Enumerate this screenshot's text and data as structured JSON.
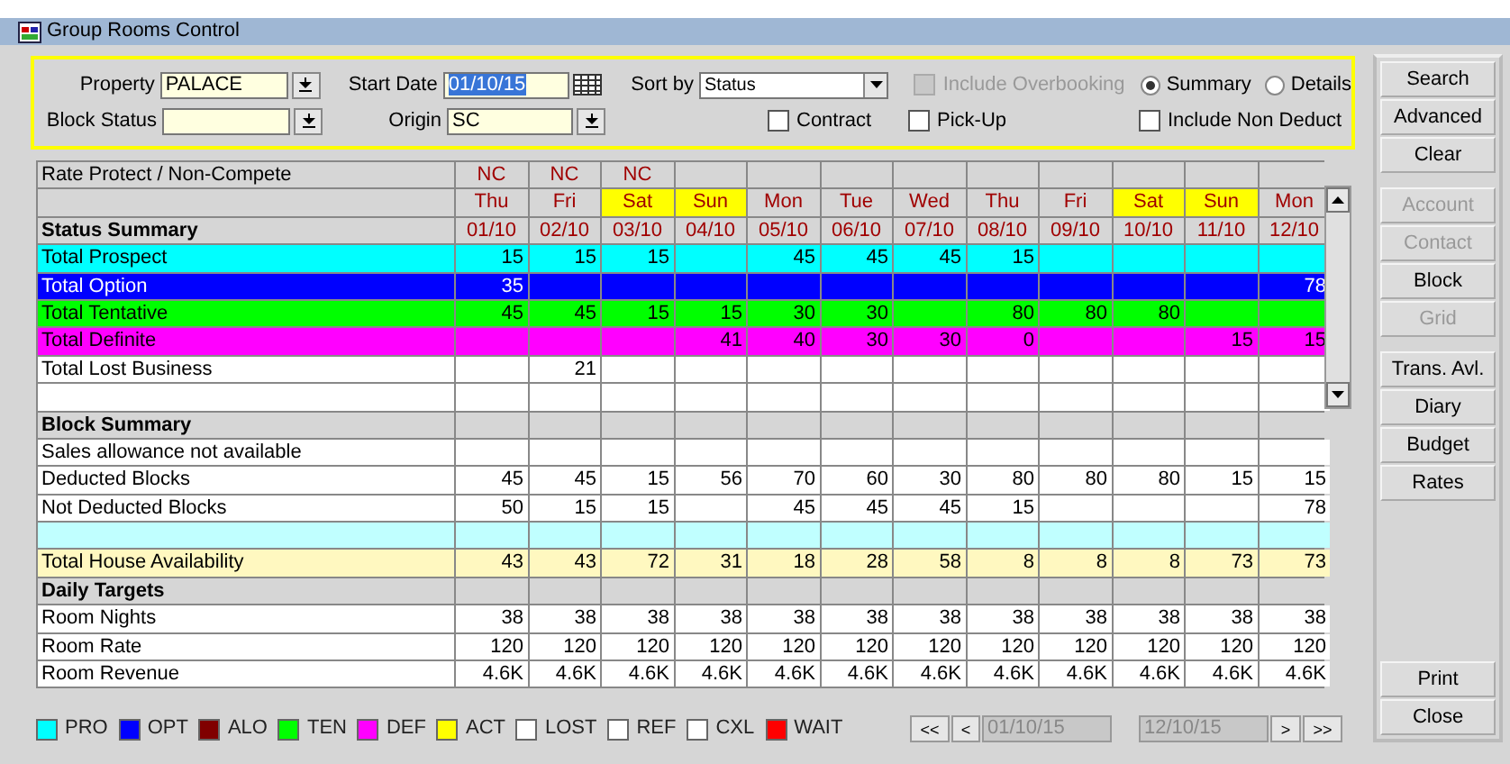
{
  "window": {
    "title": "Group Rooms Control"
  },
  "filters": {
    "property": {
      "label": "Property",
      "value": "PALACE"
    },
    "start_date": {
      "label": "Start Date",
      "value": "01/10/15",
      "selected": true
    },
    "sort_by": {
      "label": "Sort by",
      "value": "Status"
    },
    "block_status": {
      "label": "Block Status"
    },
    "origin": {
      "label": "Origin",
      "value": "SC"
    },
    "checkboxes": [
      {
        "label": "Include Overbooking",
        "checked": false,
        "disabled": true
      },
      {
        "label": "Contract",
        "checked": false,
        "disabled": false
      },
      {
        "label": "Pick-Up",
        "checked": false,
        "disabled": false
      },
      {
        "label": "Include Non Deduct",
        "checked": false,
        "disabled": false
      }
    ],
    "view": [
      {
        "label": "Summary",
        "selected": true
      },
      {
        "label": "Details",
        "selected": false
      }
    ]
  },
  "grid": {
    "title": "Rate Protect / Non-Compete",
    "section_title": "Status Summary",
    "columns": [
      {
        "nc": "NC",
        "day": "Thu",
        "date": "01/10",
        "weekend": false
      },
      {
        "nc": "NC",
        "day": "Fri",
        "date": "02/10",
        "weekend": false
      },
      {
        "nc": "NC",
        "day": "Sat",
        "date": "03/10",
        "weekend": true
      },
      {
        "day": "Sun",
        "date": "04/10",
        "weekend": true
      },
      {
        "day": "Mon",
        "date": "05/10",
        "weekend": false
      },
      {
        "day": "Tue",
        "date": "06/10",
        "weekend": false
      },
      {
        "day": "Wed",
        "date": "07/10",
        "weekend": false
      },
      {
        "day": "Thu",
        "date": "08/10",
        "weekend": false
      },
      {
        "day": "Fri",
        "date": "09/10",
        "weekend": false
      },
      {
        "day": "Sat",
        "date": "10/10",
        "weekend": true
      },
      {
        "day": "Sun",
        "date": "11/10",
        "weekend": true
      },
      {
        "day": "Mon",
        "date": "12/10",
        "weekend": false
      }
    ],
    "rows": [
      {
        "kind": "status",
        "label": "Total Prospect",
        "color": "#00ffff",
        "values": {
          "0": "15",
          "1": "15",
          "2": "15",
          "4": "45",
          "5": "45",
          "6": "45",
          "7": "15"
        }
      },
      {
        "kind": "status",
        "label": "Total Option",
        "color": "#0000ff",
        "values": {
          "0": "35",
          "11": "78"
        }
      },
      {
        "kind": "status",
        "label": "Total Tentative",
        "color": "#00ff00",
        "values": {
          "0": "45",
          "1": "45",
          "2": "15",
          "3": "15",
          "4": "30",
          "5": "30",
          "7": "80",
          "8": "80",
          "9": "80"
        }
      },
      {
        "kind": "status",
        "label": "Total Definite",
        "color": "#ff00ff",
        "values": {
          "3": "41",
          "4": "40",
          "5": "30",
          "6": "30",
          "7": "0",
          "10": "15",
          "11": "15"
        }
      },
      {
        "kind": "plain",
        "label": "Total Lost Business",
        "values": {
          "1": "21"
        }
      },
      {
        "kind": "blank"
      },
      {
        "kind": "section",
        "label": "Block Summary"
      },
      {
        "kind": "note",
        "label": "Sales allowance not available"
      },
      {
        "kind": "plain",
        "label": "Deducted Blocks",
        "values": [
          "45",
          "45",
          "15",
          "56",
          "70",
          "60",
          "30",
          "80",
          "80",
          "80",
          "15",
          "15"
        ]
      },
      {
        "kind": "plain",
        "label": "Not Deducted Blocks",
        "values": {
          "0": "50",
          "1": "15",
          "2": "15",
          "4": "45",
          "5": "45",
          "6": "45",
          "7": "15",
          "11": "78"
        }
      },
      {
        "kind": "band"
      },
      {
        "kind": "availability",
        "label": "Total House Availability",
        "values": [
          "43",
          "43",
          "72",
          "31",
          "18",
          "28",
          "58",
          "8",
          "8",
          "8",
          "73",
          "73"
        ]
      },
      {
        "kind": "section",
        "label": "Daily Targets"
      },
      {
        "kind": "plain",
        "label": "Room Nights",
        "values": [
          "38",
          "38",
          "38",
          "38",
          "38",
          "38",
          "38",
          "38",
          "38",
          "38",
          "38",
          "38"
        ]
      },
      {
        "kind": "plain",
        "label": "Room Rate",
        "values": [
          "120",
          "120",
          "120",
          "120",
          "120",
          "120",
          "120",
          "120",
          "120",
          "120",
          "120",
          "120"
        ]
      },
      {
        "kind": "plain",
        "label": "Room Revenue",
        "values": [
          "4.6K",
          "4.6K",
          "4.6K",
          "4.6K",
          "4.6K",
          "4.6K",
          "4.6K",
          "4.6K",
          "4.6K",
          "4.6K",
          "4.6K",
          "4.6K"
        ]
      }
    ]
  },
  "legend": [
    {
      "code": "PRO",
      "color": "#00ffff"
    },
    {
      "code": "OPT",
      "color": "#0000ff"
    },
    {
      "code": "ALO",
      "color": "#800000"
    },
    {
      "code": "TEN",
      "color": "#00ff00"
    },
    {
      "code": "DEF",
      "color": "#ff00ff"
    },
    {
      "code": "ACT",
      "color": "#ffff00"
    },
    {
      "code": "LOST",
      "color": "#ffffff"
    },
    {
      "code": "REF",
      "color": "#ffffff"
    },
    {
      "code": "CXL",
      "color": "#ffffff"
    },
    {
      "code": "WAIT",
      "color": "#ff0000"
    }
  ],
  "navigation": {
    "first": "<<",
    "previous": "<",
    "from": "01/10/15",
    "to": "12/10/15",
    "next": ">",
    "last": ">>"
  },
  "button_groups": [
    [
      {
        "label": "Search",
        "disabled": false
      },
      {
        "label": "Advanced",
        "disabled": false
      },
      {
        "label": "Clear",
        "disabled": false
      }
    ],
    [
      {
        "label": "Account",
        "disabled": true
      },
      {
        "label": "Contact",
        "disabled": true
      },
      {
        "label": "Block",
        "disabled": false
      },
      {
        "label": "Grid",
        "disabled": true
      }
    ],
    [
      {
        "label": "Trans. Avl.",
        "disabled": false
      },
      {
        "label": "Diary",
        "disabled": false
      },
      {
        "label": "Budget",
        "disabled": false
      },
      {
        "label": "Rates",
        "disabled": false
      }
    ],
    [
      {
        "label": "Print",
        "disabled": false
      },
      {
        "label": "Close",
        "disabled": false
      }
    ]
  ]
}
